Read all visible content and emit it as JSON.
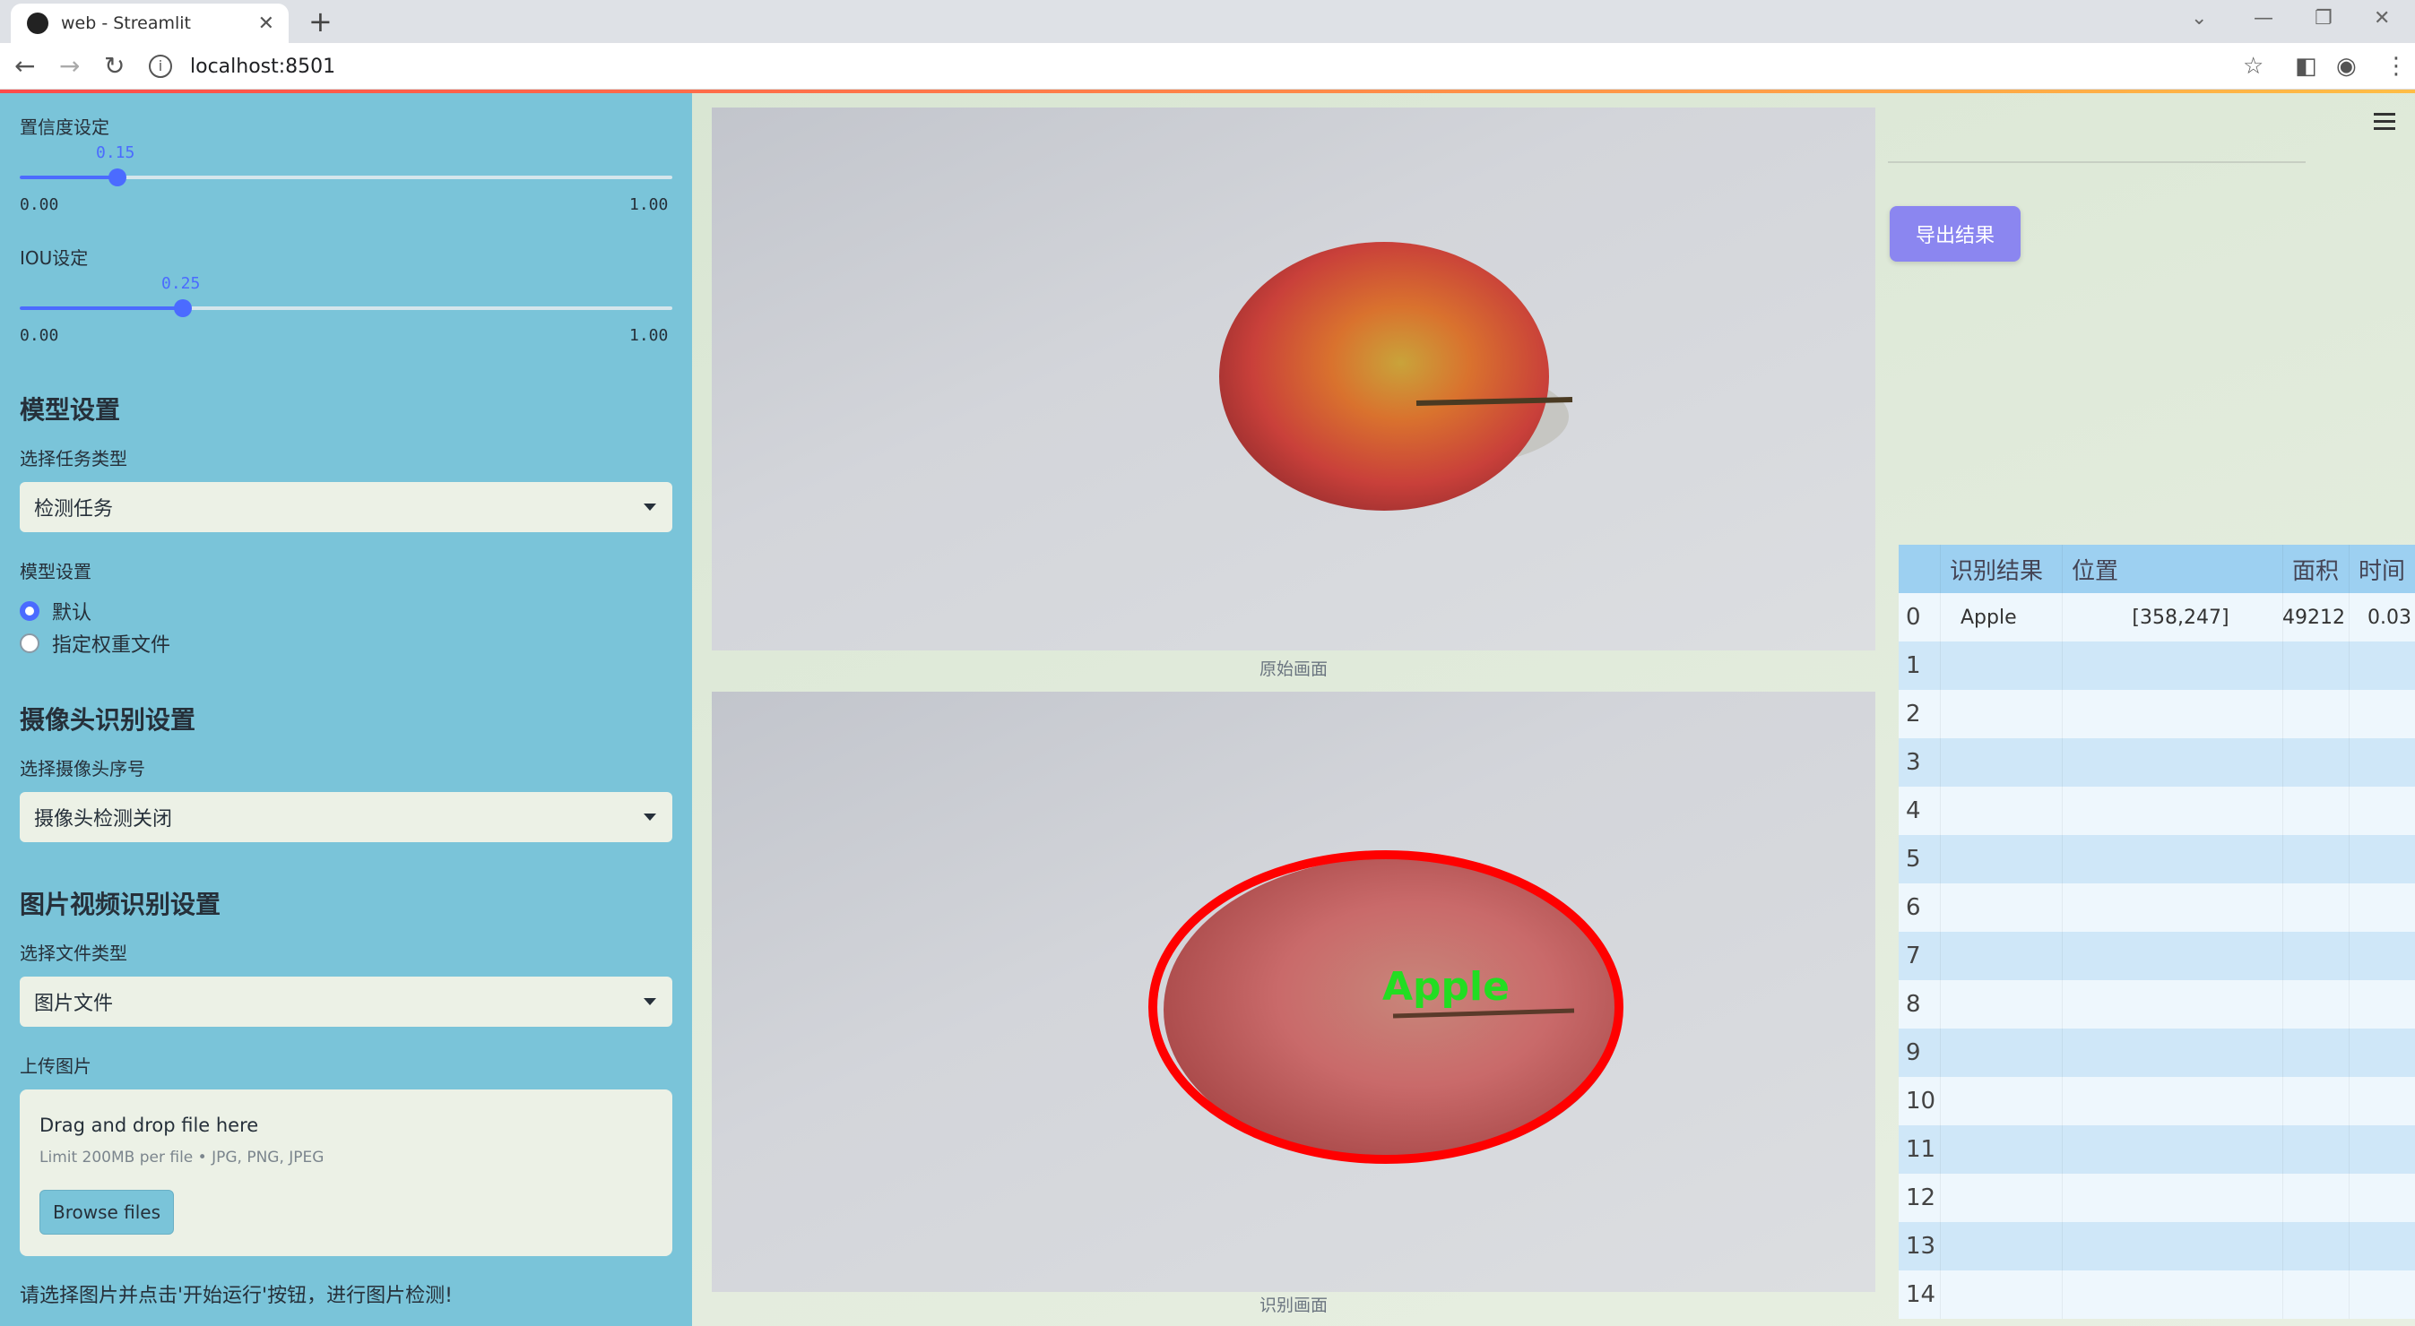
{
  "browser": {
    "tab_title": "web - Streamlit",
    "url": "localhost:8501"
  },
  "sidebar": {
    "confidence": {
      "label": "置信度设定",
      "value": "0.15",
      "min": "0.00",
      "max": "1.00",
      "fraction": 0.15
    },
    "iou": {
      "label": "IOU设定",
      "value": "0.25",
      "min": "0.00",
      "max": "1.00",
      "fraction": 0.25
    },
    "model_heading": "模型设置",
    "task_label": "选择任务类型",
    "task_value": "检测任务",
    "model_label": "模型设置",
    "model_options": [
      "默认",
      "指定权重文件"
    ],
    "model_selected": 0,
    "camera_heading": "摄像头识别设置",
    "camera_label": "选择摄像头序号",
    "camera_value": "摄像头检测关闭",
    "media_heading": "图片视频识别设置",
    "filetype_label": "选择文件类型",
    "filetype_value": "图片文件",
    "upload_label": "上传图片",
    "uploader": {
      "title": "Drag and drop file here",
      "limit": "Limit 200MB per file • JPG, PNG, JPEG",
      "button": "Browse files"
    },
    "hint": "请选择图片并点击'开始运行'按钮，进行图片检测!"
  },
  "main": {
    "original_caption": "原始画面",
    "result_caption": "识别画面",
    "detection_label": "Apple",
    "export_button": "导出结果"
  },
  "table": {
    "headers": [
      "识别结果",
      "位置",
      "面积",
      "时间"
    ],
    "rows": [
      {
        "index": "0",
        "result": "Apple",
        "position": "[358,247]",
        "area": "49212",
        "time": "0.03"
      },
      {
        "index": "1"
      },
      {
        "index": "2"
      },
      {
        "index": "3"
      },
      {
        "index": "4"
      },
      {
        "index": "5"
      },
      {
        "index": "6"
      },
      {
        "index": "7"
      },
      {
        "index": "8"
      },
      {
        "index": "9"
      },
      {
        "index": "10"
      },
      {
        "index": "11"
      },
      {
        "index": "12"
      },
      {
        "index": "13"
      },
      {
        "index": "14"
      }
    ]
  },
  "colors": {
    "sidebar_bg": "#7ac4d9",
    "accent": "#4b6bff",
    "export_button": "#8b86f0",
    "detection_box": "#ff0000",
    "detection_text": "#22dd22"
  }
}
